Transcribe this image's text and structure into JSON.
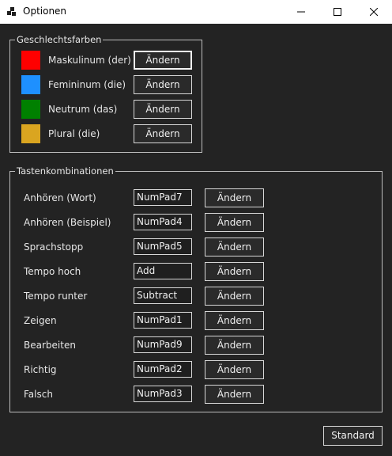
{
  "window": {
    "title": "Optionen",
    "icon": "options-app-icon",
    "controls": [
      "minimize-icon",
      "maximize-icon",
      "close-icon"
    ]
  },
  "gender_colors": {
    "title": "Geschlechtsfarben",
    "items": [
      {
        "label": "Maskulinum (der)",
        "color": "#ff0000",
        "button": "Ändern"
      },
      {
        "label": "Femininum (die)",
        "color": "#1e90ff",
        "button": "Ändern"
      },
      {
        "label": "Neutrum (das)",
        "color": "#008000",
        "button": "Ändern"
      },
      {
        "label": "Plural (die)",
        "color": "#daa520",
        "button": "Ändern"
      }
    ]
  },
  "shortcuts": {
    "title": "Tastenkombinationen",
    "items": [
      {
        "label": "Anhören (Wort)",
        "key": "NumPad7",
        "button": "Ändern"
      },
      {
        "label": "Anhören (Beispiel)",
        "key": "NumPad4",
        "button": "Ändern"
      },
      {
        "label": "Sprachstopp",
        "key": "NumPad5",
        "button": "Ändern"
      },
      {
        "label": "Tempo hoch",
        "key": "Add",
        "button": "Ändern"
      },
      {
        "label": "Tempo runter",
        "key": "Subtract",
        "button": "Ändern"
      },
      {
        "label": "Zeigen",
        "key": "NumPad1",
        "button": "Ändern"
      },
      {
        "label": "Bearbeiten",
        "key": "NumPad9",
        "button": "Ändern"
      },
      {
        "label": "Richtig",
        "key": "NumPad2",
        "button": "Ändern"
      },
      {
        "label": "Falsch",
        "key": "NumPad3",
        "button": "Ändern"
      }
    ]
  },
  "footer": {
    "default_button": "Standard"
  }
}
